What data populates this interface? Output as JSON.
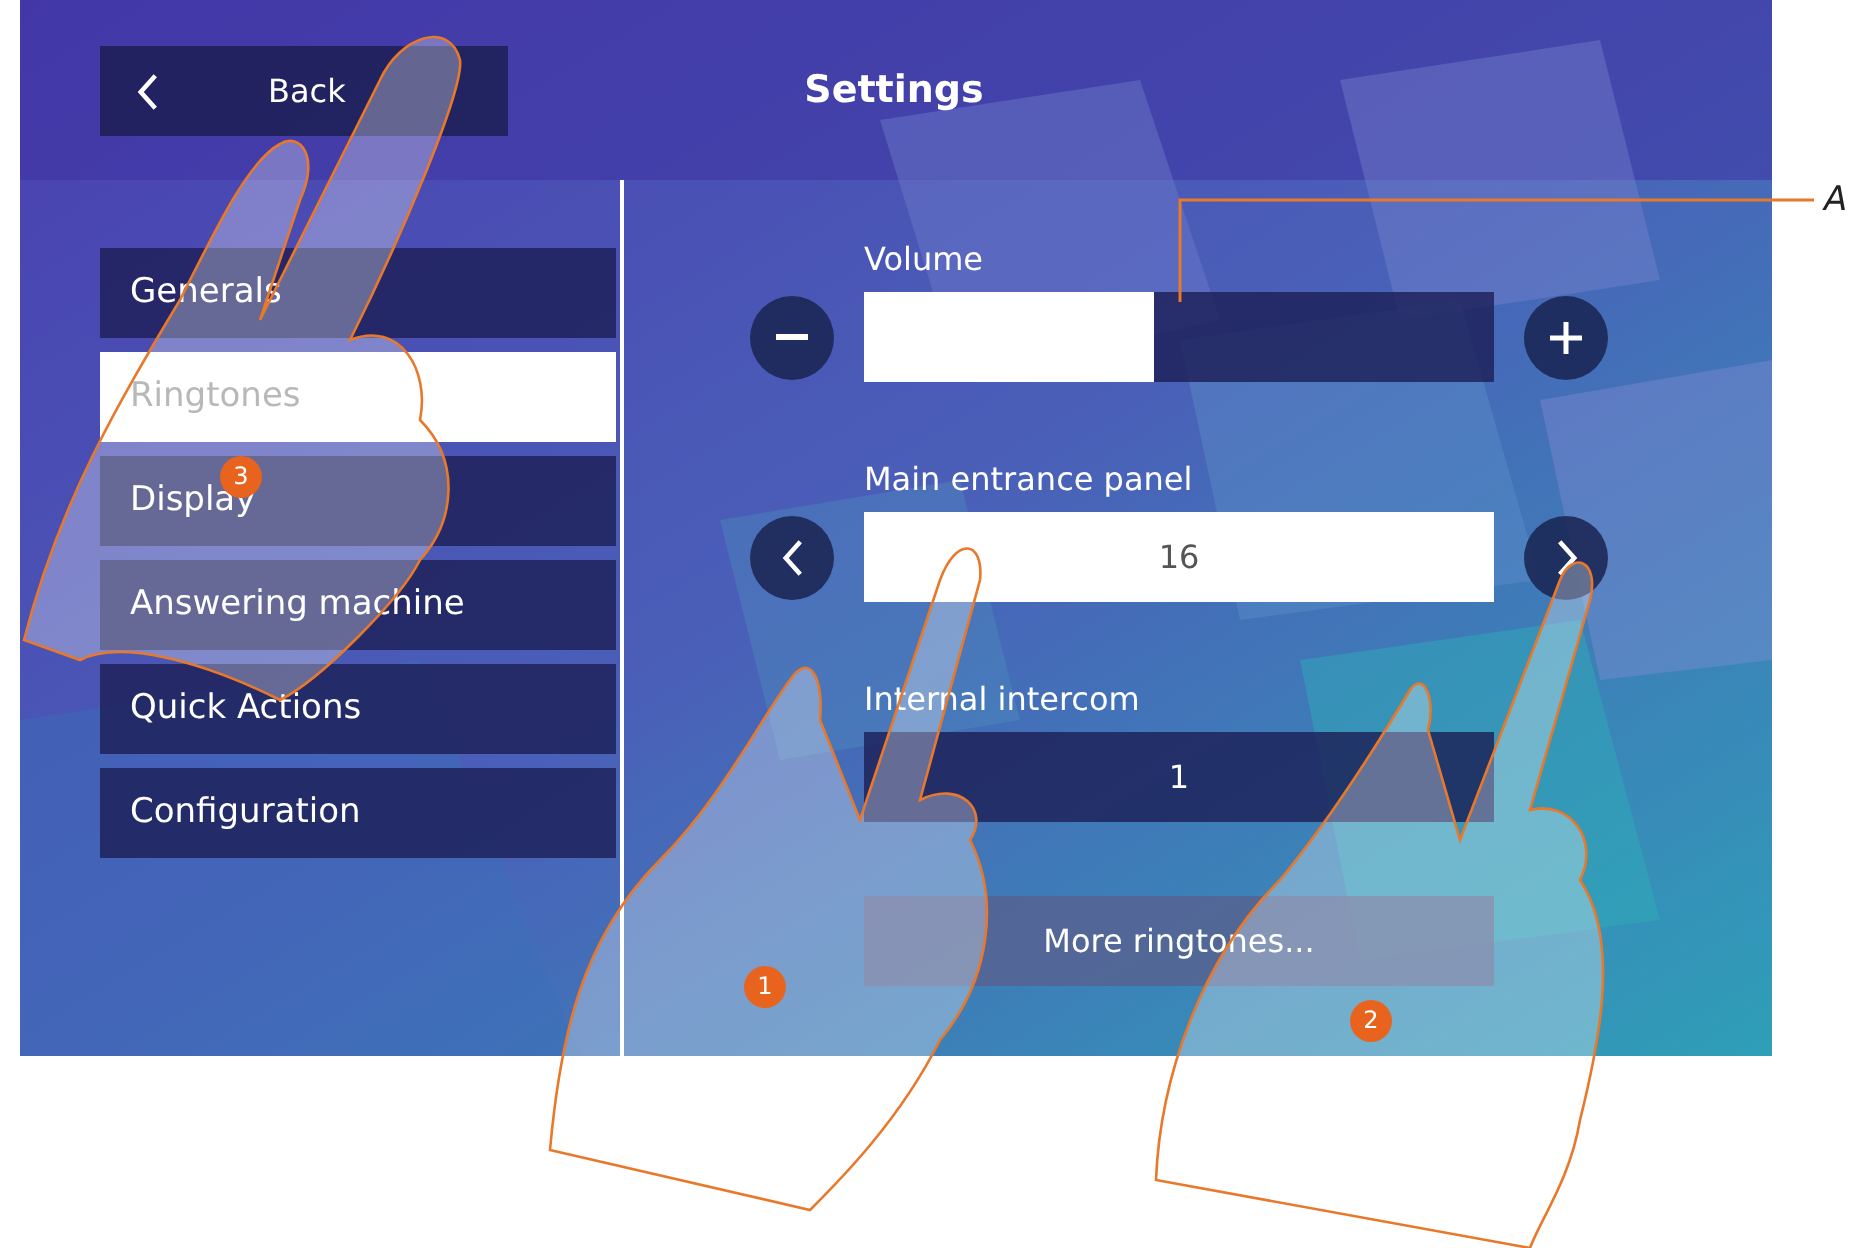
{
  "header": {
    "back_label": "Back",
    "title": "Settings"
  },
  "menu": [
    {
      "label": "Generals",
      "selected": false
    },
    {
      "label": "Ringtones",
      "selected": true
    },
    {
      "label": "Display",
      "selected": false
    },
    {
      "label": "Answering machine",
      "selected": false
    },
    {
      "label": "Quick Actions",
      "selected": false
    },
    {
      "label": "Configuration",
      "selected": false
    }
  ],
  "volume": {
    "label": "Volume",
    "level": 0.46
  },
  "selectors": [
    {
      "label": "Main entrance panel",
      "value": "16",
      "selected": true
    },
    {
      "label": "Internal intercom",
      "value": "1",
      "selected": false
    }
  ],
  "more_button": "More ringtones...",
  "callouts": [
    "1",
    "2",
    "3"
  ],
  "annotation": "A"
}
